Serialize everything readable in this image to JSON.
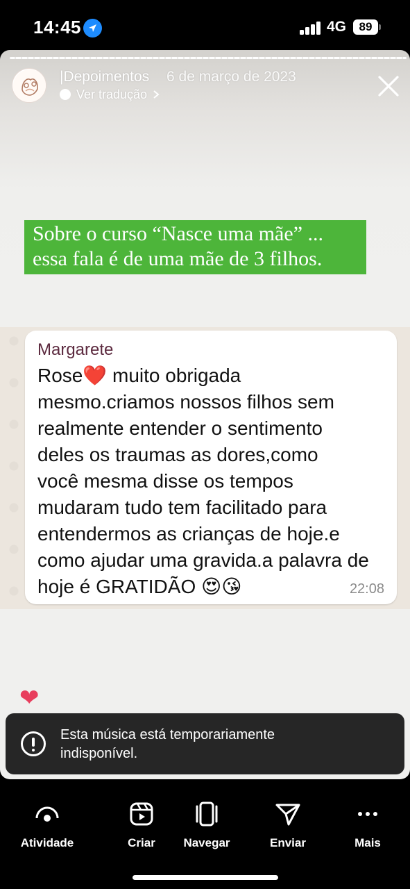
{
  "status": {
    "time": "14:45",
    "network": "4G",
    "battery": "89"
  },
  "story": {
    "author": "|Depoimentos",
    "date": "6 de março de 2023",
    "translate_label": "Ver tradução",
    "caption": "Sobre o curso “Nasce uma mãe” ...\nessa fala é de uma mãe de 3 filhos.",
    "chat": {
      "sender": "Margarete",
      "message": "Rose❤️ muito obrigada\nmesmo.criamos nossos filhos sem\nrealmente entender o sentimento\ndeles  os traumas as dores,como\nvocê mesma disse os tempos\nmudaram tudo tem facilitado para\nentendermos as crianças de hoje.e\ncomo ajudar uma gravida.a palavra de\nhoje é GRATIDÃO 😍😘",
      "time": "22:08"
    }
  },
  "toast": {
    "text": "Esta música está temporariamente indisponível."
  },
  "bottom_nav": {
    "items": [
      {
        "label": "Atividade",
        "icon": "activity-icon"
      },
      {
        "label": "Criar",
        "icon": "create-reels-icon"
      },
      {
        "label": "Navegar",
        "icon": "browse-icon"
      },
      {
        "label": "Enviar",
        "icon": "send-icon"
      },
      {
        "label": "Mais",
        "icon": "more-icon"
      }
    ]
  },
  "colors": {
    "caption_bg": "#4db53a",
    "heart": "#e83e5d",
    "location_badge": "#1e8cff",
    "sender_name": "#5c2a3f"
  }
}
